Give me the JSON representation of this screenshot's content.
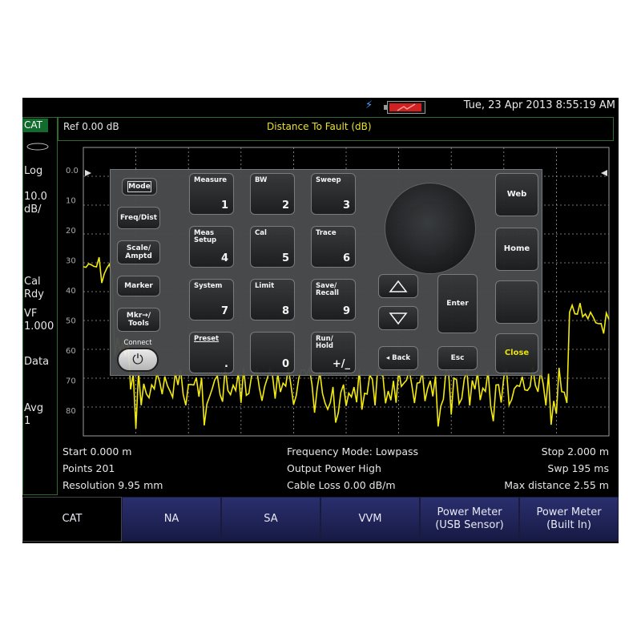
{
  "status": {
    "datetime": "Tue, 23 Apr 2013 8:55:19 AM",
    "usb_icon": "usb-icon",
    "battery_icon": "battery-icon"
  },
  "left": {
    "mode": "CAT",
    "scale_type": "Log",
    "scale_value": "10.0\ndB/",
    "cal_status": "Cal\nRdy",
    "vf": "VF\n1.000",
    "data": "Data",
    "avg": "Avg\n1"
  },
  "header": {
    "ref": "Ref 0.00 dB",
    "title": "Distance To Fault (dB)"
  },
  "plot": {
    "y_labels": [
      "0.0",
      "10",
      "20",
      "30",
      "40",
      "50",
      "60",
      "70",
      "80"
    ],
    "trace_color": "#f2ea0c",
    "grid_color": "#9a9a9a"
  },
  "info": {
    "start": "Start 0.000 m",
    "points": "Points 201",
    "resolution": "Resolution 9.95 mm",
    "freq_mode": "Frequency Mode: Lowpass",
    "output_power": "Output Power High",
    "cable_loss": "Cable Loss 0.00  dB/m",
    "stop": "Stop 2.000 m",
    "swp": "Swp 195 ms",
    "max_distance": "Max distance 2.55  m"
  },
  "softkeys": [
    {
      "label": "CAT",
      "active": true
    },
    {
      "label": "NA",
      "active": false
    },
    {
      "label": "SA",
      "active": false
    },
    {
      "label": "VVM",
      "active": false
    },
    {
      "label": "Power Meter\n(USB Sensor)",
      "active": false
    },
    {
      "label": "Power Meter\n(Built In)",
      "active": false
    }
  ],
  "keypad": {
    "side": [
      "Mode",
      "Freq/Dist",
      "Scale/\nAmptd",
      "Marker",
      "Mkr→/\nTools"
    ],
    "connect": "Connect",
    "grid": [
      {
        "label": "Measure",
        "num": "1"
      },
      {
        "label": "BW",
        "num": "2"
      },
      {
        "label": "Sweep",
        "num": "3"
      },
      {
        "label": "Meas\nSetup",
        "num": "4"
      },
      {
        "label": "Cal",
        "num": "5"
      },
      {
        "label": "Trace",
        "num": "6"
      },
      {
        "label": "System",
        "num": "7"
      },
      {
        "label": "Limit",
        "num": "8"
      },
      {
        "label": "Save/\nRecall",
        "num": "9"
      },
      {
        "label": "Preset",
        "num": "."
      },
      {
        "label": "",
        "num": "0"
      },
      {
        "label": "Run/\nHold",
        "num": "+/_"
      }
    ],
    "enter": "Enter",
    "back": "◂ Back",
    "esc": "Esc",
    "web": "Web",
    "home": "Home",
    "close": "Close",
    "close_color": "#f2ea0c"
  }
}
